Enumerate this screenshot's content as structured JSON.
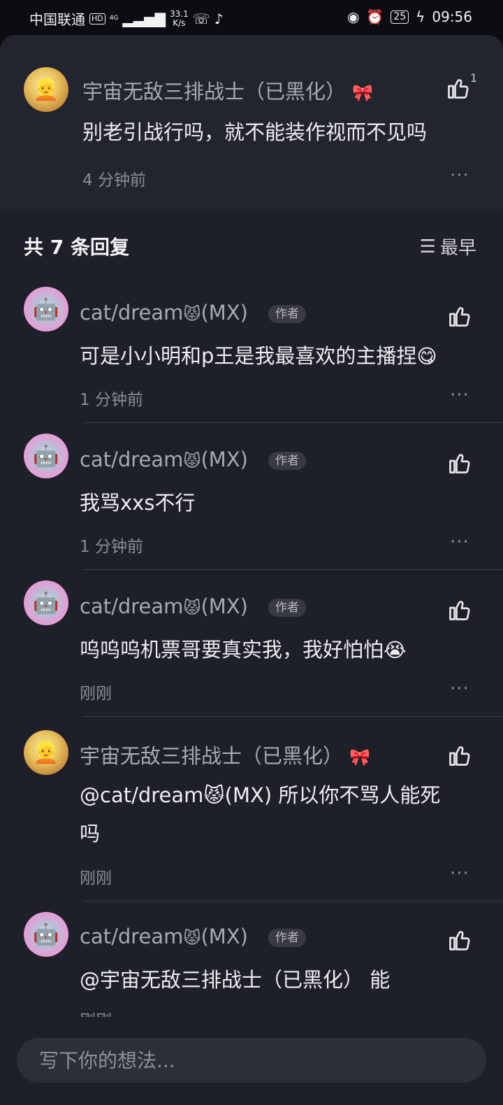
{
  "status_bar": {
    "carrier": "中国联通",
    "hd": "HD",
    "network": "4G",
    "speed_value": "33.1",
    "speed_unit": "K/s",
    "battery": "25",
    "time": "09:56"
  },
  "parent_comment": {
    "username": "宇宙无敌三排战士（已黑化）",
    "badge_emoji": "🎀",
    "text": "别老引战行吗，就不能装作视而不见吗",
    "time": "4 分钟前",
    "like_count": "1"
  },
  "replies_header": {
    "title": "共 7 条回复",
    "sort_label": "最早"
  },
  "replies": [
    {
      "username": "cat/dream",
      "emoji": "😾",
      "suffix": "(MX)",
      "author_tag": "作者",
      "text": "可是小小明和p王是我最喜欢的主播捏",
      "text_emoji": "😋",
      "time": "1 分钟前"
    },
    {
      "username": "cat/dream",
      "emoji": "😾",
      "suffix": "(MX)",
      "author_tag": "作者",
      "text": "我骂xxs不行",
      "text_emoji": "",
      "time": "1 分钟前"
    },
    {
      "username": "cat/dream",
      "emoji": "😾",
      "suffix": "(MX)",
      "author_tag": "作者",
      "text": "呜呜呜机票哥要真实我，我好怕怕",
      "text_emoji": "😭",
      "time": "刚刚"
    },
    {
      "username": "宇宙无敌三排战士（已黑化）",
      "emoji": "🎀",
      "suffix": "",
      "author_tag": "",
      "text_line1": "@cat/dream😾(MX)  所以你不骂人能死",
      "text_line2": "吗",
      "time": "刚刚"
    },
    {
      "username": "cat/dream",
      "emoji": "😾",
      "suffix": "(MX)",
      "author_tag": "作者",
      "text": "@宇宙无敌三排战士（已黑化）  能",
      "text_emoji": "",
      "time": "刚刚"
    }
  ],
  "input": {
    "placeholder": "写下你的想法..."
  },
  "icons": {
    "like": "thumbs-up-icon",
    "more": "more-dots-icon",
    "sort": "sort-icon"
  }
}
